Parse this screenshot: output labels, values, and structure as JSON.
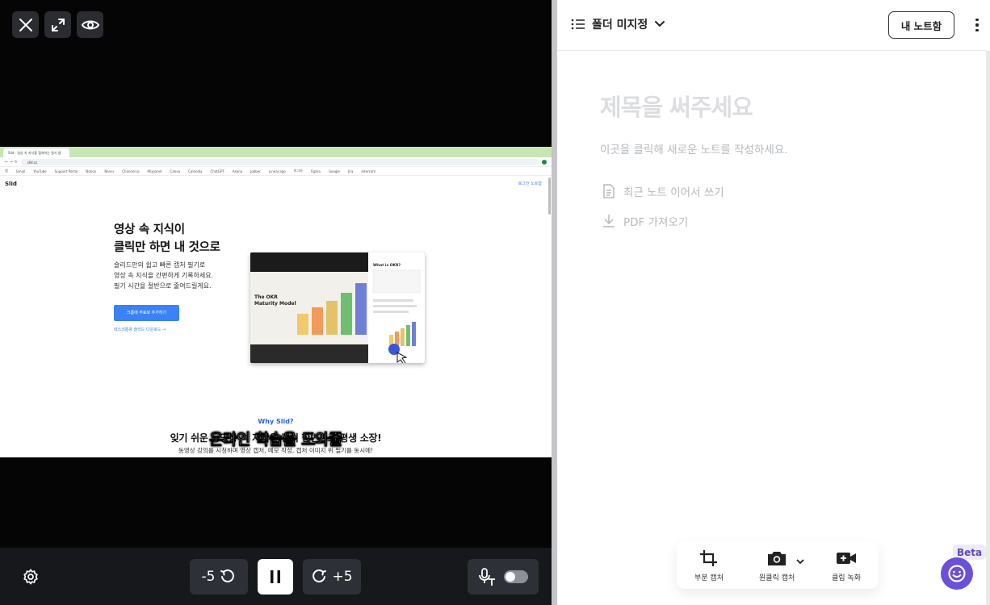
{
  "player": {
    "subtitle": "온라인 학습을 도와줄",
    "rewind_label": "-5",
    "forward_label": "+5"
  },
  "embedded_page": {
    "tab_title": "Slid - 영상 속 지식을 캡쳐하는 필기 앱",
    "url": "slid.cc",
    "bookmarks": [
      "앱",
      "Gmail",
      "YouTube",
      "Support Portal",
      "Notion",
      "Naver",
      "Channel.io",
      "Mixpanel",
      "Canva",
      "Calendly",
      "ChatGPT",
      "Asana",
      "Jobber",
      "Linear.app",
      "피그마",
      "Figma",
      "Google",
      "Jira",
      "Intercom"
    ],
    "logo": "Slid",
    "nav": "로그인   노트함",
    "headline_1": "영상 속 지식이",
    "headline_2": "클릭만 하면 내 것으로",
    "desc_1": "슬리드만의 쉽고 빠른 캡처 필기로",
    "desc_2": "영상 속 지식을 간편하게 기록하세요.",
    "desc_3": "필기 시간을 절반으로 줄여드릴게요.",
    "cta": "크롬에 무료로 추가하기",
    "link": "데스크톱용 슬리드 다운로드 →",
    "preview_title": "The OKR Maturity Model",
    "preview_side_title": "What is OKR?",
    "why": "Why Slid?",
    "section_title": "잊기 쉬운 동영상 속 지식을 캡쳐 한번으로 평생 소장!",
    "section_sub": "동영상 강의를 시청하며 영상 캡처, 메모 작성, 캡처 이미지 위 필기를 동시에!"
  },
  "note": {
    "folder_label": "폴더 미지정",
    "notebox_button": "내 노트함",
    "title_placeholder": "제목을 써주세요",
    "body_placeholder": "이곳을 클릭해 새로운 노트를 작성하세요.",
    "option_recent": "최근 노트 이어서 쓰기",
    "option_pdf": "PDF 가져오기"
  },
  "capture": {
    "partial": "부분 캡처",
    "one_click": "원클릭 캡처",
    "clip": "클립 녹화"
  },
  "beta_badge": "Beta",
  "colors": {
    "accent": "#6b50d8",
    "player_bg": "#050506",
    "control_bar": "#16181c",
    "slid_blue": "#3b82f6"
  }
}
